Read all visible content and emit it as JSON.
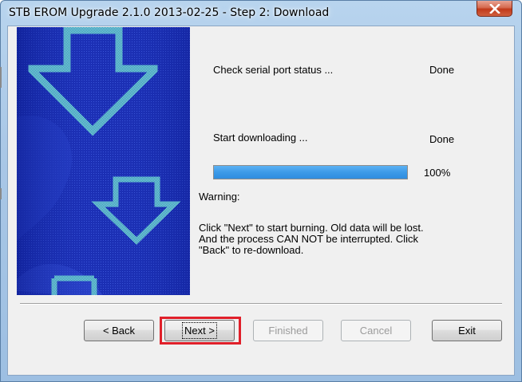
{
  "window": {
    "title": "STB EROM Upgrade 2.1.0 2013-02-25 - Step 2: Download"
  },
  "status": {
    "serial_port_label": "Check serial port status ...",
    "serial_port_value": "Done",
    "downloading_label": "Start downloading ...",
    "downloading_value": "Done"
  },
  "progress": {
    "value": 100,
    "percent_label": "100%"
  },
  "warning": {
    "heading": "Warning:",
    "lines": [
      "Click \"Next\" to start burning. Old data will be lost.",
      "And the process CAN NOT be interrupted. Click",
      "\"Back\" to re-download."
    ]
  },
  "buttons": {
    "back": "< Back",
    "next": "Next >",
    "finished": "Finished",
    "cancel": "Cancel",
    "exit": "Exit"
  },
  "icons": {
    "close": "close-icon",
    "banner": "download-arrows-icon"
  },
  "colors": {
    "banner_blue": "#1d2fb8",
    "arrow_teal": "#6fd3c4",
    "progress_fill": "#3c9ae8",
    "highlight_red": "#e0202a"
  }
}
